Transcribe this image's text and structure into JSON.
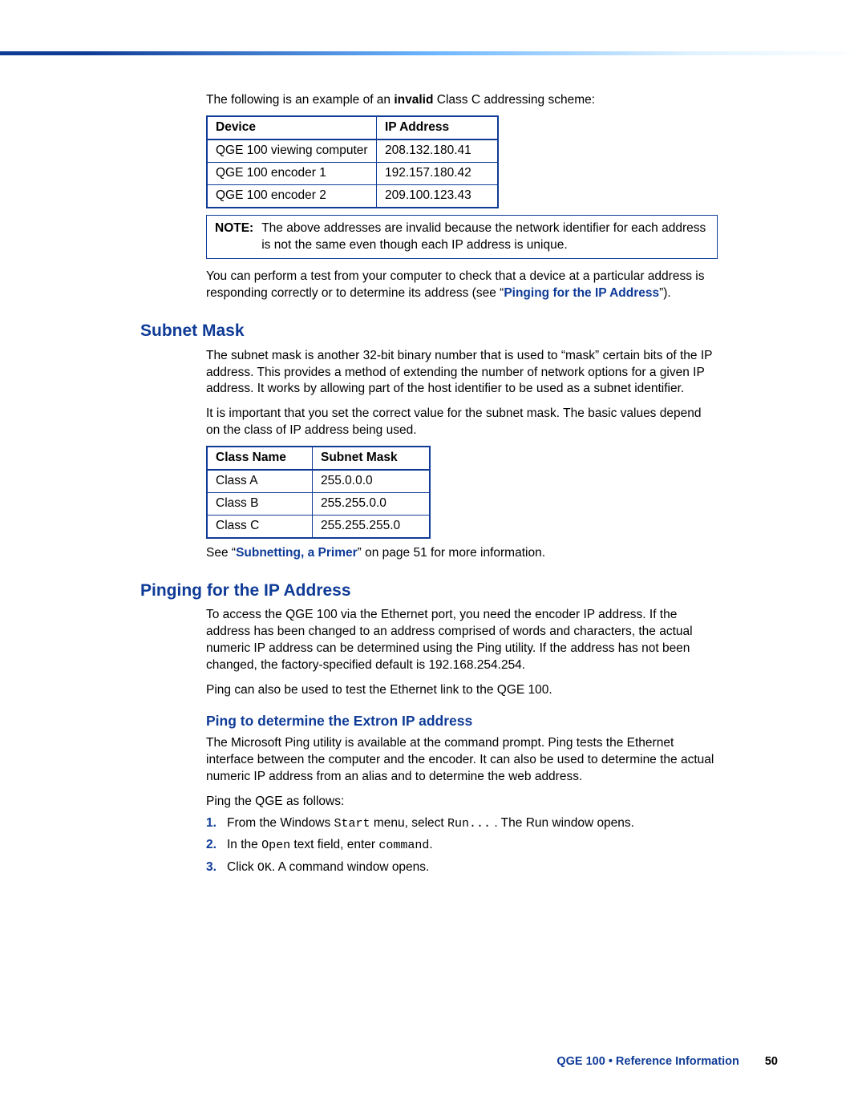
{
  "intro": {
    "p1_a": "The following is an example of an ",
    "p1_b": "invalid",
    "p1_c": " Class C addressing scheme:"
  },
  "table1": {
    "headers": {
      "device": "Device",
      "ip": "IP Address"
    },
    "rows": [
      {
        "device": "QGE 100 viewing computer",
        "ip": "208.132.180.41"
      },
      {
        "device": "QGE 100 encoder 1",
        "ip": "192.157.180.42"
      },
      {
        "device": "QGE 100  encoder 2",
        "ip": "209.100.123.43"
      }
    ]
  },
  "note": {
    "label": "NOTE:",
    "text": "The above addresses are invalid because the network identifier for each address is not the same even though each IP address is unique."
  },
  "after_note": {
    "p_a": "You can perform a test from your computer to check that a device at a particular address is responding correctly or to determine its address (see “",
    "link": "Pinging for the IP Address",
    "p_b": "”)."
  },
  "subnet": {
    "heading": "Subnet Mask",
    "p1": "The subnet mask is another 32-bit binary number that is used to “mask” certain bits of the IP address. This provides a method of extending the number of network options for a given IP address. It works by allowing part of the host identifier to be used as a subnet identifier.",
    "p2": "It is important that you set the correct value for the subnet mask. The basic values depend on the class of IP address being used."
  },
  "table2": {
    "headers": {
      "class": "Class Name",
      "mask": "Subnet Mask"
    },
    "rows": [
      {
        "class": "Class A",
        "mask": "255.0.0.0"
      },
      {
        "class": "Class B",
        "mask": "255.255.0.0"
      },
      {
        "class": "Class C",
        "mask": "255.255.255.0"
      }
    ]
  },
  "subnet_footer": {
    "a": "See “",
    "link": "Subnetting, a Primer",
    "b": "” on page 51 for more information."
  },
  "pinging": {
    "heading": "Pinging for the IP Address",
    "p1": "To access the QGE 100 via the Ethernet port, you need the encoder IP address. If the address has been changed to an address comprised of words and characters, the actual numeric IP address can be determined using the Ping utility. If the address has not been changed, the factory-specified default is 192.168.254.254.",
    "p2": "Ping can also be used to test the Ethernet link to the QGE 100."
  },
  "ping_sub": {
    "heading": "Ping to determine the Extron IP address",
    "p1": "The Microsoft Ping utility is available at the command prompt. Ping tests the Ethernet interface between the computer and the encoder. It can also be used to determine the actual numeric IP address from an alias and to determine the web address.",
    "p2": "Ping the QGE as follows:"
  },
  "steps": {
    "n1": "1.",
    "s1_a": "From the Windows ",
    "s1_b": "Start",
    "s1_c": " menu, select ",
    "s1_d": "Run...",
    "s1_e": " . The Run window opens.",
    "n2": "2.",
    "s2_a": "In the ",
    "s2_b": "Open",
    "s2_c": " text field, enter ",
    "s2_d": "command",
    "s2_e": ".",
    "n3": "3.",
    "s3_a": "Click ",
    "s3_b": "OK",
    "s3_c": ". A command window opens."
  },
  "footer": {
    "text": "QGE 100 • Reference Information",
    "page": "50"
  }
}
